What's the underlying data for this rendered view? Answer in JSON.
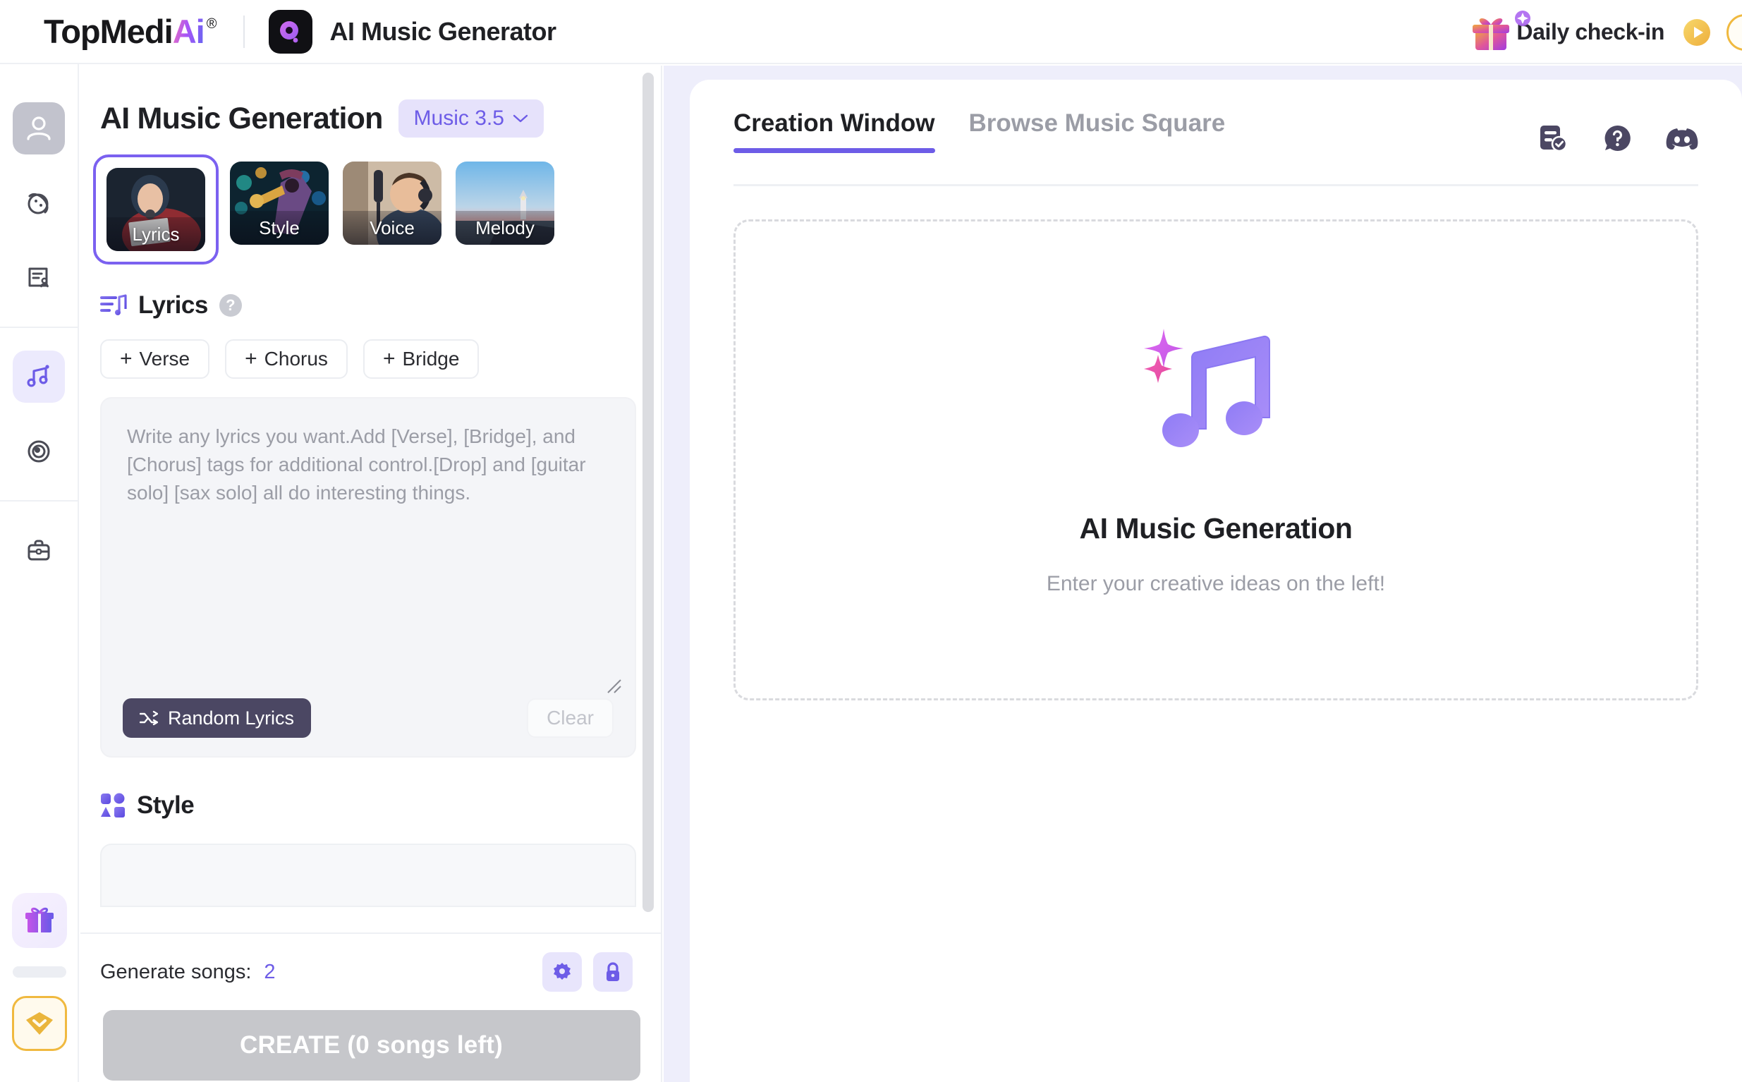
{
  "header": {
    "brand_main": "TopMedi",
    "brand_accent": "Ai",
    "brand_reg": "®",
    "app_title": "AI Music Generator",
    "app_icon": "music-disc-icon",
    "checkin_label": "Daily check-in",
    "gift_icon": "gift-icon",
    "play_icon": "play-circle-icon"
  },
  "rail": {
    "items": [
      {
        "name": "account",
        "icon": "user-avatar-icon",
        "active": false
      },
      {
        "name": "explore",
        "icon": "planet-icon",
        "active": false
      },
      {
        "name": "documents",
        "icon": "document-user-icon",
        "active": false
      },
      {
        "name": "music",
        "icon": "music-note-icon",
        "active": true
      },
      {
        "name": "library",
        "icon": "vinyl-disc-icon",
        "active": false
      },
      {
        "name": "workspace",
        "icon": "briefcase-icon",
        "active": false
      }
    ],
    "bottom": [
      {
        "name": "rewards",
        "icon": "gift-box-icon"
      },
      {
        "name": "collapse-handle",
        "icon": "pill-handle-icon"
      },
      {
        "name": "premium",
        "icon": "diamond-icon"
      }
    ]
  },
  "left_panel": {
    "title": "AI Music Generation",
    "model": {
      "label": "Music 3.5",
      "chevron": "chevron-down-icon"
    },
    "thumbnails": [
      {
        "label": "Lyrics",
        "selected": true
      },
      {
        "label": "Style",
        "selected": false
      },
      {
        "label": "Voice",
        "selected": false
      },
      {
        "label": "Melody",
        "selected": false
      }
    ],
    "lyrics_section": {
      "icon": "lyrics-lines-note-icon",
      "title": "Lyrics",
      "help": "?",
      "tags": [
        {
          "plus": "+",
          "label": "Verse"
        },
        {
          "plus": "+",
          "label": "Chorus"
        },
        {
          "plus": "+",
          "label": "Bridge"
        }
      ],
      "textarea_value": "",
      "textarea_placeholder": "Write any lyrics you want.Add [Verse], [Bridge], and [Chorus] tags for additional control.[Drop] and [guitar solo] [sax solo] all do interesting things.",
      "random_label": "Random Lyrics",
      "random_icon": "shuffle-icon",
      "clear_label": "Clear"
    },
    "style_section": {
      "icon": "style-shapes-icon",
      "title": "Style"
    },
    "footer": {
      "generate_label": "Generate songs:",
      "generate_count": "2",
      "settings_icon": "gear-icon",
      "lock_icon": "lock-icon",
      "create_label": "CREATE (0 songs left)"
    }
  },
  "right_panel": {
    "tabs": [
      {
        "label": "Creation Window",
        "active": true
      },
      {
        "label": "Browse Music Square",
        "active": false
      }
    ],
    "icons": [
      {
        "name": "task-list-check-icon"
      },
      {
        "name": "help-question-icon"
      },
      {
        "name": "discord-icon"
      }
    ],
    "empty_state": {
      "illustration": "music-note-sparkle-icon",
      "title": "AI Music Generation",
      "subtitle": "Enter your creative ideas on the left!"
    }
  },
  "colors": {
    "accent": "#6d5ce7",
    "accent_soft": "#e8e5fc",
    "right_bg": "#eeeefb",
    "dark_btn": "#4b4763",
    "disabled_btn": "#c6c7cb",
    "gold": "#f0b93f"
  }
}
